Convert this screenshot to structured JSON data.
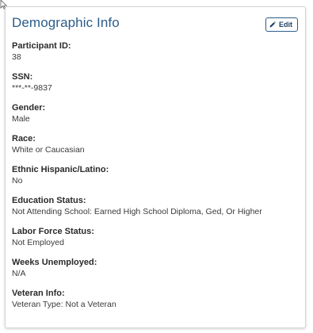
{
  "card": {
    "title": "Demographic Info",
    "edit_label": "Edit"
  },
  "fields": [
    {
      "label": "Participant ID:",
      "value": "38"
    },
    {
      "label": "SSN:",
      "value": "***-**-9837"
    },
    {
      "label": "Gender:",
      "value": "Male"
    },
    {
      "label": "Race:",
      "value": "White or Caucasian"
    },
    {
      "label": "Ethnic Hispanic/Latino:",
      "value": "No"
    },
    {
      "label": "Education Status:",
      "value": "Not Attending School: Earned High School Diploma, Ged, Or Higher"
    },
    {
      "label": "Labor Force Status:",
      "value": "Not Employed"
    },
    {
      "label": "Weeks Unemployed:",
      "value": "N/A"
    },
    {
      "label": "Veteran Info:",
      "value": "Veteran Type: Not a Veteran"
    }
  ],
  "colors": {
    "title": "#2b5d8a",
    "border": "#d6d6d6"
  },
  "icons": {
    "cursor": "mouse-pointer-icon",
    "edit": "pencil-icon"
  }
}
